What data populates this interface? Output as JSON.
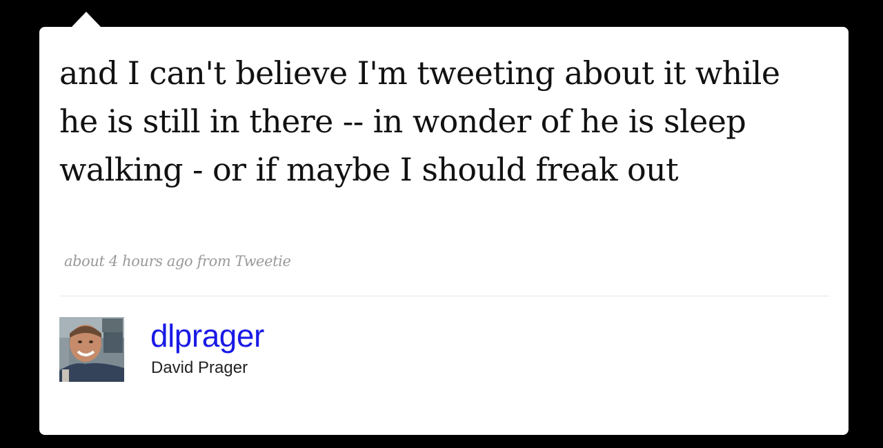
{
  "tweet": {
    "text": "and I can't believe I'm tweeting about it while he is still in there -- in wonder of he is sleep walking - or if maybe I should freak out",
    "timestamp": "about 4 hours ago",
    "source": "from Tweetie"
  },
  "author": {
    "screen_name": "dlprager",
    "full_name": "David Prager",
    "avatar_icon": "user-photo"
  },
  "colors": {
    "background": "#000000",
    "card": "#ffffff",
    "link": "#1a1ae6",
    "meta": "#999999"
  }
}
